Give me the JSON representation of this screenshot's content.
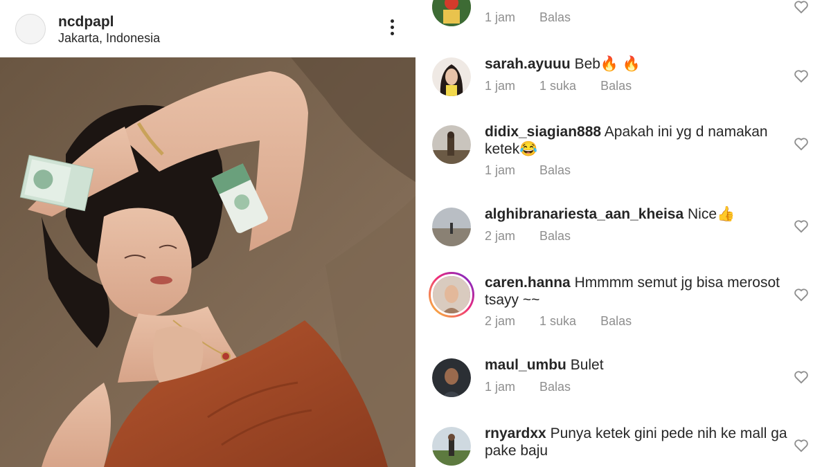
{
  "post": {
    "username": "ncdpapl",
    "location": "Jakarta, Indonesia",
    "product_label": "ketiak"
  },
  "comments": [
    {
      "username": "",
      "text": "",
      "time": "1 jam",
      "likes": "",
      "reply": "Balas"
    },
    {
      "username": "sarah.ayuuu",
      "text": "Beb🔥 🔥",
      "time": "1 jam",
      "likes": "1 suka",
      "reply": "Balas"
    },
    {
      "username": "didix_siagian888",
      "text": "Apakah ini yg d namakan ketek😂",
      "time": "1 jam",
      "likes": "",
      "reply": "Balas"
    },
    {
      "username": "alghibranariesta_aan_kheisa",
      "text": "Nice👍",
      "time": "2 jam",
      "likes": "",
      "reply": "Balas"
    },
    {
      "username": "caren.hanna",
      "text": "Hmmmm semut jg bisa merosot tsayy ~~",
      "time": "2 jam",
      "likes": "1 suka",
      "reply": "Balas"
    },
    {
      "username": "maul_umbu",
      "text": "Bulet",
      "time": "1 jam",
      "likes": "",
      "reply": "Balas"
    },
    {
      "username": "rnyardxx",
      "text": "Punya ketek gini pede nih ke mall ga pake baju",
      "time": "",
      "likes": "",
      "reply": ""
    }
  ],
  "icons": {
    "more": "more-options-icon",
    "like": "heart-outline-icon"
  },
  "colors": {
    "meta": "#8e8e8e",
    "text": "#262626",
    "story_ring_start": "#f9ce34",
    "story_ring_end": "#6228d7"
  }
}
